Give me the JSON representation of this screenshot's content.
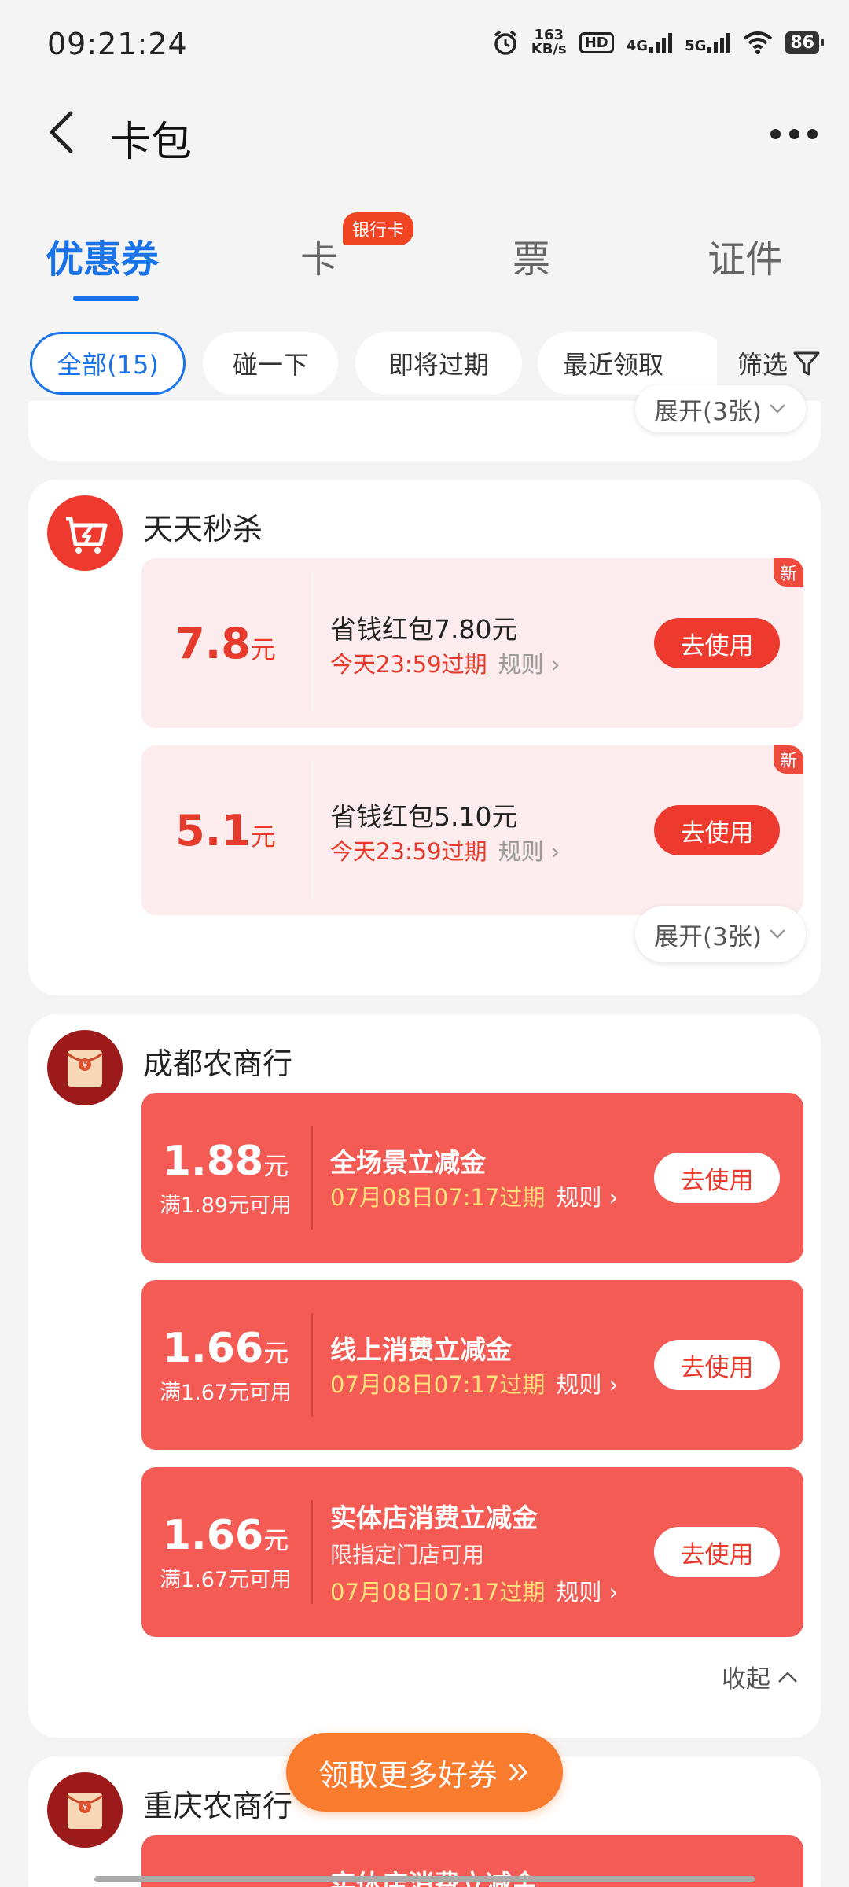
{
  "status_bar": {
    "time": "09:21:24",
    "net_speed_value": "163",
    "net_speed_unit": "KB/s",
    "hd_label": "HD",
    "sim1_label": "4G",
    "sim2_label": "5G",
    "battery": "86"
  },
  "navbar": {
    "title": "卡包"
  },
  "tabs": [
    {
      "label": "优惠券",
      "active": true
    },
    {
      "label": "卡",
      "badge": "银行卡"
    },
    {
      "label": "票"
    },
    {
      "label": "证件"
    }
  ],
  "filter_chips": [
    {
      "label": "全部(15)",
      "active": true
    },
    {
      "label": "碰一下"
    },
    {
      "label": "即将过期"
    },
    {
      "label": "最近领取"
    }
  ],
  "filter_button": "筛选",
  "top_partial": {
    "expand_label": "展开(3张)"
  },
  "merchants": [
    {
      "name": "天天秒杀",
      "coupons": [
        {
          "amount": "7.8",
          "unit": "元",
          "title": "省钱红包7.80元",
          "expire": "今天23:59过期",
          "rule": "规则",
          "button": "去使用",
          "badge": "新"
        },
        {
          "amount": "5.1",
          "unit": "元",
          "title": "省钱红包5.10元",
          "expire": "今天23:59过期",
          "rule": "规则",
          "button": "去使用",
          "badge": "新"
        }
      ],
      "expand_label": "展开(3张)"
    },
    {
      "name": "成都农商行",
      "coupons": [
        {
          "amount": "1.88",
          "unit": "元",
          "condition": "满1.89元可用",
          "title": "全场景立减金",
          "expire": "07月08日07:17过期",
          "rule": "规则",
          "button": "去使用"
        },
        {
          "amount": "1.66",
          "unit": "元",
          "condition": "满1.67元可用",
          "title": "线上消费立减金",
          "expire": "07月08日07:17过期",
          "rule": "规则",
          "button": "去使用"
        },
        {
          "amount": "1.66",
          "unit": "元",
          "condition": "满1.67元可用",
          "title": "实体店消费立减金",
          "subtitle": "限指定门店可用",
          "expire": "07月08日07:17过期",
          "rule": "规则",
          "button": "去使用"
        }
      ],
      "collapse_label": "收起"
    },
    {
      "name": "重庆农商行",
      "coupons": [
        {
          "title": "实体店消费立减金"
        }
      ]
    }
  ],
  "float_button": "领取更多好券",
  "colors": {
    "accent_blue": "#1a73e8",
    "coupon_red": "#f35b54",
    "coupon_pink": "#fdeced",
    "float_orange": "#f97b2e"
  }
}
